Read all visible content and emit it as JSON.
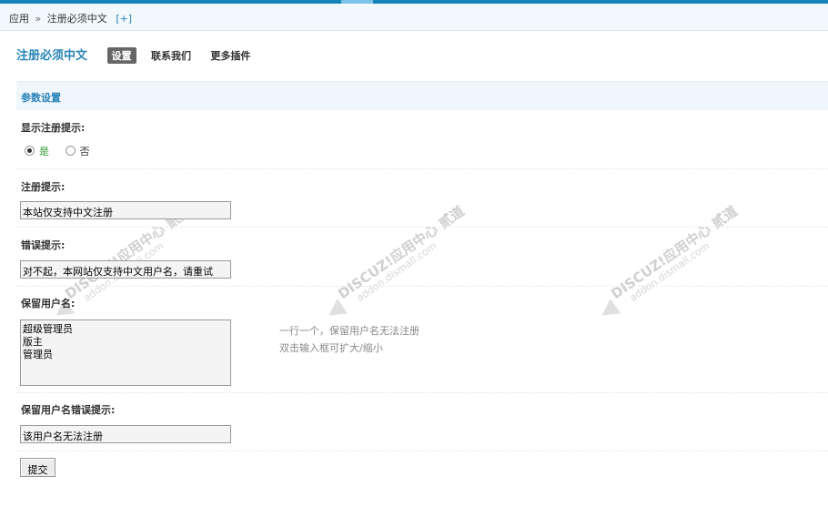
{
  "breadcrumb": {
    "root": "应用",
    "separator": "»",
    "current": "注册必须中文",
    "add": "[+]"
  },
  "header": {
    "title": "注册必须中文",
    "tabs": [
      {
        "label": "设置",
        "active": true
      },
      {
        "label": "联系我们",
        "active": false
      },
      {
        "label": "更多插件",
        "active": false
      }
    ]
  },
  "section": {
    "title": "参数设置"
  },
  "fields": {
    "show_tip": {
      "label": "显示注册提示:",
      "options": [
        "是",
        "否"
      ],
      "selected": "是"
    },
    "reg_tip": {
      "label": "注册提示:",
      "value": "本站仅支持中文注册"
    },
    "error_tip": {
      "label": "错误提示:",
      "value": "对不起，本网站仅支持中文用户名，请重试"
    },
    "reserved": {
      "label": "保留用户名:",
      "values": [
        "超级管理员",
        "版主",
        "管理员"
      ],
      "help_1": "一行一个，保留用户名无法注册",
      "help_2": "双击输入框可扩大/缩小"
    },
    "reserved_error": {
      "label": "保留用户名错误提示:",
      "value": "该用户名无法注册"
    }
  },
  "submit_label": "提交",
  "watermark": {
    "brand": "DISCUZ!应用中心",
    "sub": "addon.dismall.com",
    "mark": "贰道"
  },
  "colors": {
    "accent": "#2a84b7",
    "topbar": "#1583b8",
    "radio_selected": "#2f9a2f"
  }
}
